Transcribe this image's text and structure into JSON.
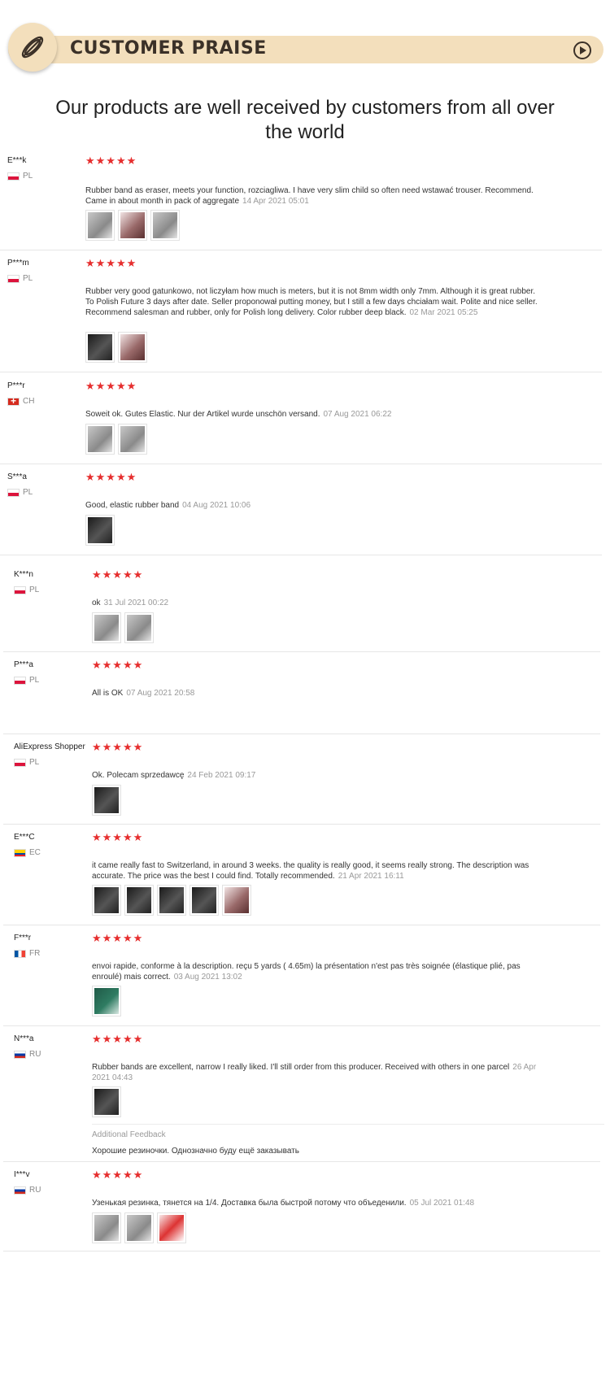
{
  "header": {
    "title": "CUSTOMER PRAISE",
    "badge_icon": "rubber-band-icon",
    "play_icon": "play-icon"
  },
  "subtitle": "Our products are well received by customers from all over the world",
  "stars": "★★★★★",
  "reviews": [
    {
      "user": "E***k",
      "country": "PL",
      "flag": "pl",
      "text": "Rubber band as eraser, meets your function, rozciagliwa. I have very slim child so often need wstawać trouser. Recommend. Came in about month in pack of aggregate",
      "date": "14 Apr 2021 05:01",
      "photos": [
        "light",
        "pink",
        "light"
      ]
    },
    {
      "user": "P***m",
      "country": "PL",
      "flag": "pl",
      "text": "Rubber very good gatunkowo, not liczyłam how much is meters, but it is not 8mm width only 7mm. Although it is great rubber. To Polish Future 3 days after date. Seller proponował putting money, but I still a few days chciałam wait. Polite and nice seller. Recommend salesman and rubber, only for Polish long delivery. Color rubber deep black.",
      "date": "02 Mar 2021 05:25",
      "photos": [
        "dark",
        "pink"
      ]
    },
    {
      "user": "P***r",
      "country": "CH",
      "flag": "ch",
      "text": "Soweit ok. Gutes Elastic. Nur der Artikel wurde unschön versand.",
      "date": "07 Aug 2021 06:22",
      "photos": [
        "light",
        "light"
      ]
    },
    {
      "user": "S***a",
      "country": "PL",
      "flag": "pl",
      "text": "Good, elastic rubber band",
      "date": "04 Aug 2021 10:06",
      "photos": [
        "dark"
      ]
    },
    {
      "user": "K***n",
      "country": "PL",
      "flag": "pl",
      "text": "ok",
      "date": "31 Jul 2021 00:22",
      "photos": [
        "light",
        "light"
      ]
    },
    {
      "user": "P***a",
      "country": "PL",
      "flag": "pl",
      "text": "All is OK",
      "date": "07 Aug 2021 20:58",
      "photos": []
    },
    {
      "user": "AliExpress Shopper",
      "country": "PL",
      "flag": "pl",
      "text": "Ok. Polecam sprzedawcę",
      "date": "24 Feb 2021 09:17",
      "photos": [
        "dark"
      ]
    },
    {
      "user": "E***C",
      "country": "EC",
      "flag": "ec",
      "text": "it came really fast to Switzerland, in around 3 weeks. the quality is really good, it seems really strong. The description was accurate. The price was the best I could find. Totally recommended.",
      "date": "21 Apr 2021 16:11",
      "photos": [
        "dark",
        "dark",
        "dark",
        "dark",
        "pink"
      ]
    },
    {
      "user": "F***r",
      "country": "FR",
      "flag": "fr",
      "text": "envoi rapide, conforme à la description. reçu 5 yards ( 4.65m) la présentation n'est pas très soignée (élastique plié, pas enroulé) mais correct.",
      "date": "03 Aug 2021 13:02",
      "photos": [
        "green"
      ]
    },
    {
      "user": "N***a",
      "country": "RU",
      "flag": "ru",
      "text": "Rubber bands are excellent, narrow I really liked. I'll still order from this producer. Received with others in one parcel",
      "date": "26 Apr 2021 04:43",
      "photos": [
        "dark"
      ],
      "additional_label": "Additional Feedback",
      "additional_text": "Хорошие резиночки. Однозначно буду ещё заказывать"
    },
    {
      "user": "I***v",
      "country": "RU",
      "flag": "ru",
      "text": "Узенькая резинка, тянется на 1/4. Доставка была быстрой потому что объеденили.",
      "date": "05 Jul 2021 01:48",
      "photos": [
        "light",
        "light",
        "red"
      ]
    }
  ]
}
